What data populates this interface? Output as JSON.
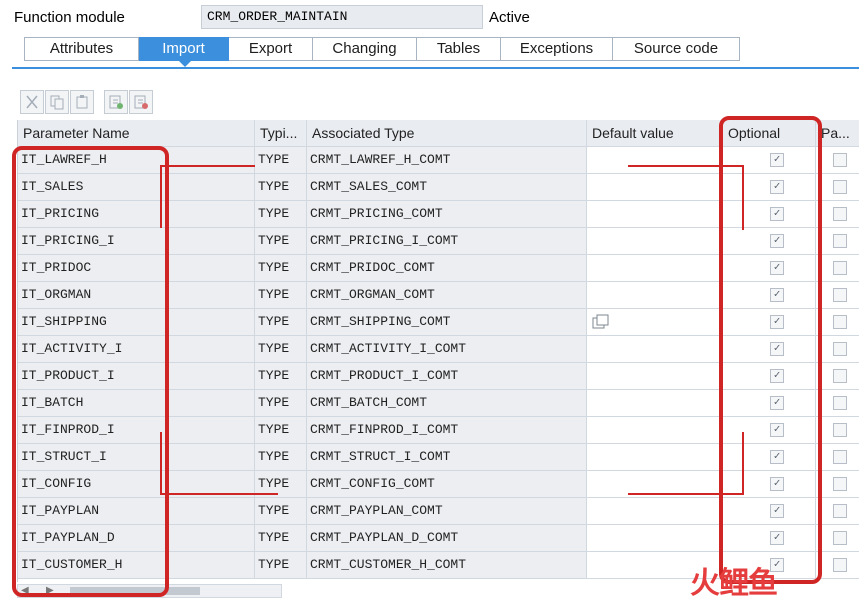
{
  "header": {
    "label": "Function module",
    "name": "CRM_ORDER_MAINTAIN",
    "status": "Active"
  },
  "tabs": [
    {
      "label": "Attributes",
      "active": false
    },
    {
      "label": "Import",
      "active": true
    },
    {
      "label": "Export",
      "active": false
    },
    {
      "label": "Changing",
      "active": false
    },
    {
      "label": "Tables",
      "active": false
    },
    {
      "label": "Exceptions",
      "active": false
    },
    {
      "label": "Source code",
      "active": false
    }
  ],
  "toolbar": {
    "icons": [
      "cut-icon",
      "copy-icon",
      "paste-icon",
      "insert-row-icon",
      "delete-row-icon"
    ]
  },
  "table": {
    "columns": [
      "Parameter Name",
      "Typi...",
      "Associated Type",
      "Default value",
      "Optional",
      "Pa..."
    ],
    "rows": [
      {
        "name": "IT_LAWREF_H",
        "typing": "TYPE",
        "assoc": "CRMT_LAWREF_H_COMT",
        "optional": true,
        "pass_value": false
      },
      {
        "name": "IT_SALES",
        "typing": "TYPE",
        "assoc": "CRMT_SALES_COMT",
        "optional": true,
        "pass_value": false
      },
      {
        "name": "IT_PRICING",
        "typing": "TYPE",
        "assoc": "CRMT_PRICING_COMT",
        "optional": true,
        "pass_value": false
      },
      {
        "name": "IT_PRICING_I",
        "typing": "TYPE",
        "assoc": "CRMT_PRICING_I_COMT",
        "optional": true,
        "pass_value": false
      },
      {
        "name": "IT_PRIDOC",
        "typing": "TYPE",
        "assoc": "CRMT_PRIDOC_COMT",
        "optional": true,
        "pass_value": false
      },
      {
        "name": "IT_ORGMAN",
        "typing": "TYPE",
        "assoc": "CRMT_ORGMAN_COMT",
        "optional": true,
        "pass_value": false
      },
      {
        "name": "IT_SHIPPING",
        "typing": "TYPE",
        "assoc": "CRMT_SHIPPING_COMT",
        "optional": true,
        "pass_value": false
      },
      {
        "name": "IT_ACTIVITY_I",
        "typing": "TYPE",
        "assoc": "CRMT_ACTIVITY_I_COMT",
        "optional": true,
        "pass_value": false
      },
      {
        "name": "IT_PRODUCT_I",
        "typing": "TYPE",
        "assoc": "CRMT_PRODUCT_I_COMT",
        "optional": true,
        "pass_value": false
      },
      {
        "name": "IT_BATCH",
        "typing": "TYPE",
        "assoc": "CRMT_BATCH_COMT",
        "optional": true,
        "pass_value": false
      },
      {
        "name": "IT_FINPROD_I",
        "typing": "TYPE",
        "assoc": "CRMT_FINPROD_I_COMT",
        "optional": true,
        "pass_value": false
      },
      {
        "name": "IT_STRUCT_I",
        "typing": "TYPE",
        "assoc": "CRMT_STRUCT_I_COMT",
        "optional": true,
        "pass_value": false
      },
      {
        "name": "IT_CONFIG",
        "typing": "TYPE",
        "assoc": "CRMT_CONFIG_COMT",
        "optional": true,
        "pass_value": false
      },
      {
        "name": "IT_PAYPLAN",
        "typing": "TYPE",
        "assoc": "CRMT_PAYPLAN_COMT",
        "optional": true,
        "pass_value": false
      },
      {
        "name": "IT_PAYPLAN_D",
        "typing": "TYPE",
        "assoc": "CRMT_PAYPLAN_D_COMT",
        "optional": true,
        "pass_value": false
      },
      {
        "name": "IT_CUSTOMER_H",
        "typing": "TYPE",
        "assoc": "CRMT_CUSTOMER_H_COMT",
        "optional": true,
        "pass_value": false
      }
    ]
  },
  "watermark": "火鲤鱼",
  "colors": {
    "accent": "#3b8fdc",
    "highlight": "#d02525"
  }
}
